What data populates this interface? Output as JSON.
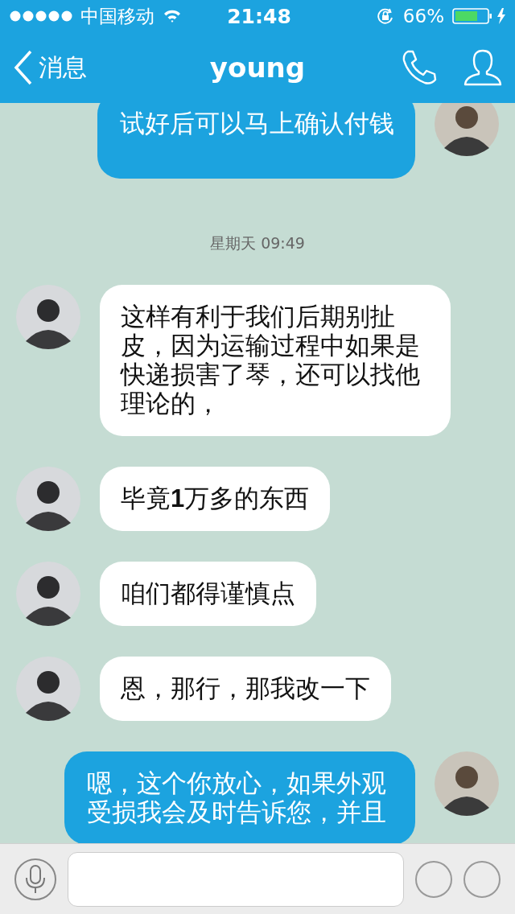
{
  "status_bar": {
    "carrier": "中国移动",
    "time": "21:48",
    "battery": "66%"
  },
  "nav": {
    "back": "消息",
    "title": "young"
  },
  "messages": [
    {
      "kind": "message",
      "outgoing": true,
      "text": "试好后可以马上确认付钱"
    },
    {
      "kind": "time",
      "text": "星期天 09:49"
    },
    {
      "kind": "message",
      "outgoing": false,
      "text": "这样有利于我们后期别扯皮，因为运输过程中如果是快递损害了琴，还可以找他理论的，"
    },
    {
      "kind": "message",
      "outgoing": false,
      "text": "毕竟**1**万多的东西"
    },
    {
      "kind": "message",
      "outgoing": false,
      "text": "咱们都得谨慎点"
    },
    {
      "kind": "message",
      "outgoing": false,
      "text": "恩，那行，那我改一下"
    },
    {
      "kind": "message",
      "outgoing": true,
      "text": "嗯，这个你放心，如果外观受损我会及时告诉您，并且"
    }
  ]
}
